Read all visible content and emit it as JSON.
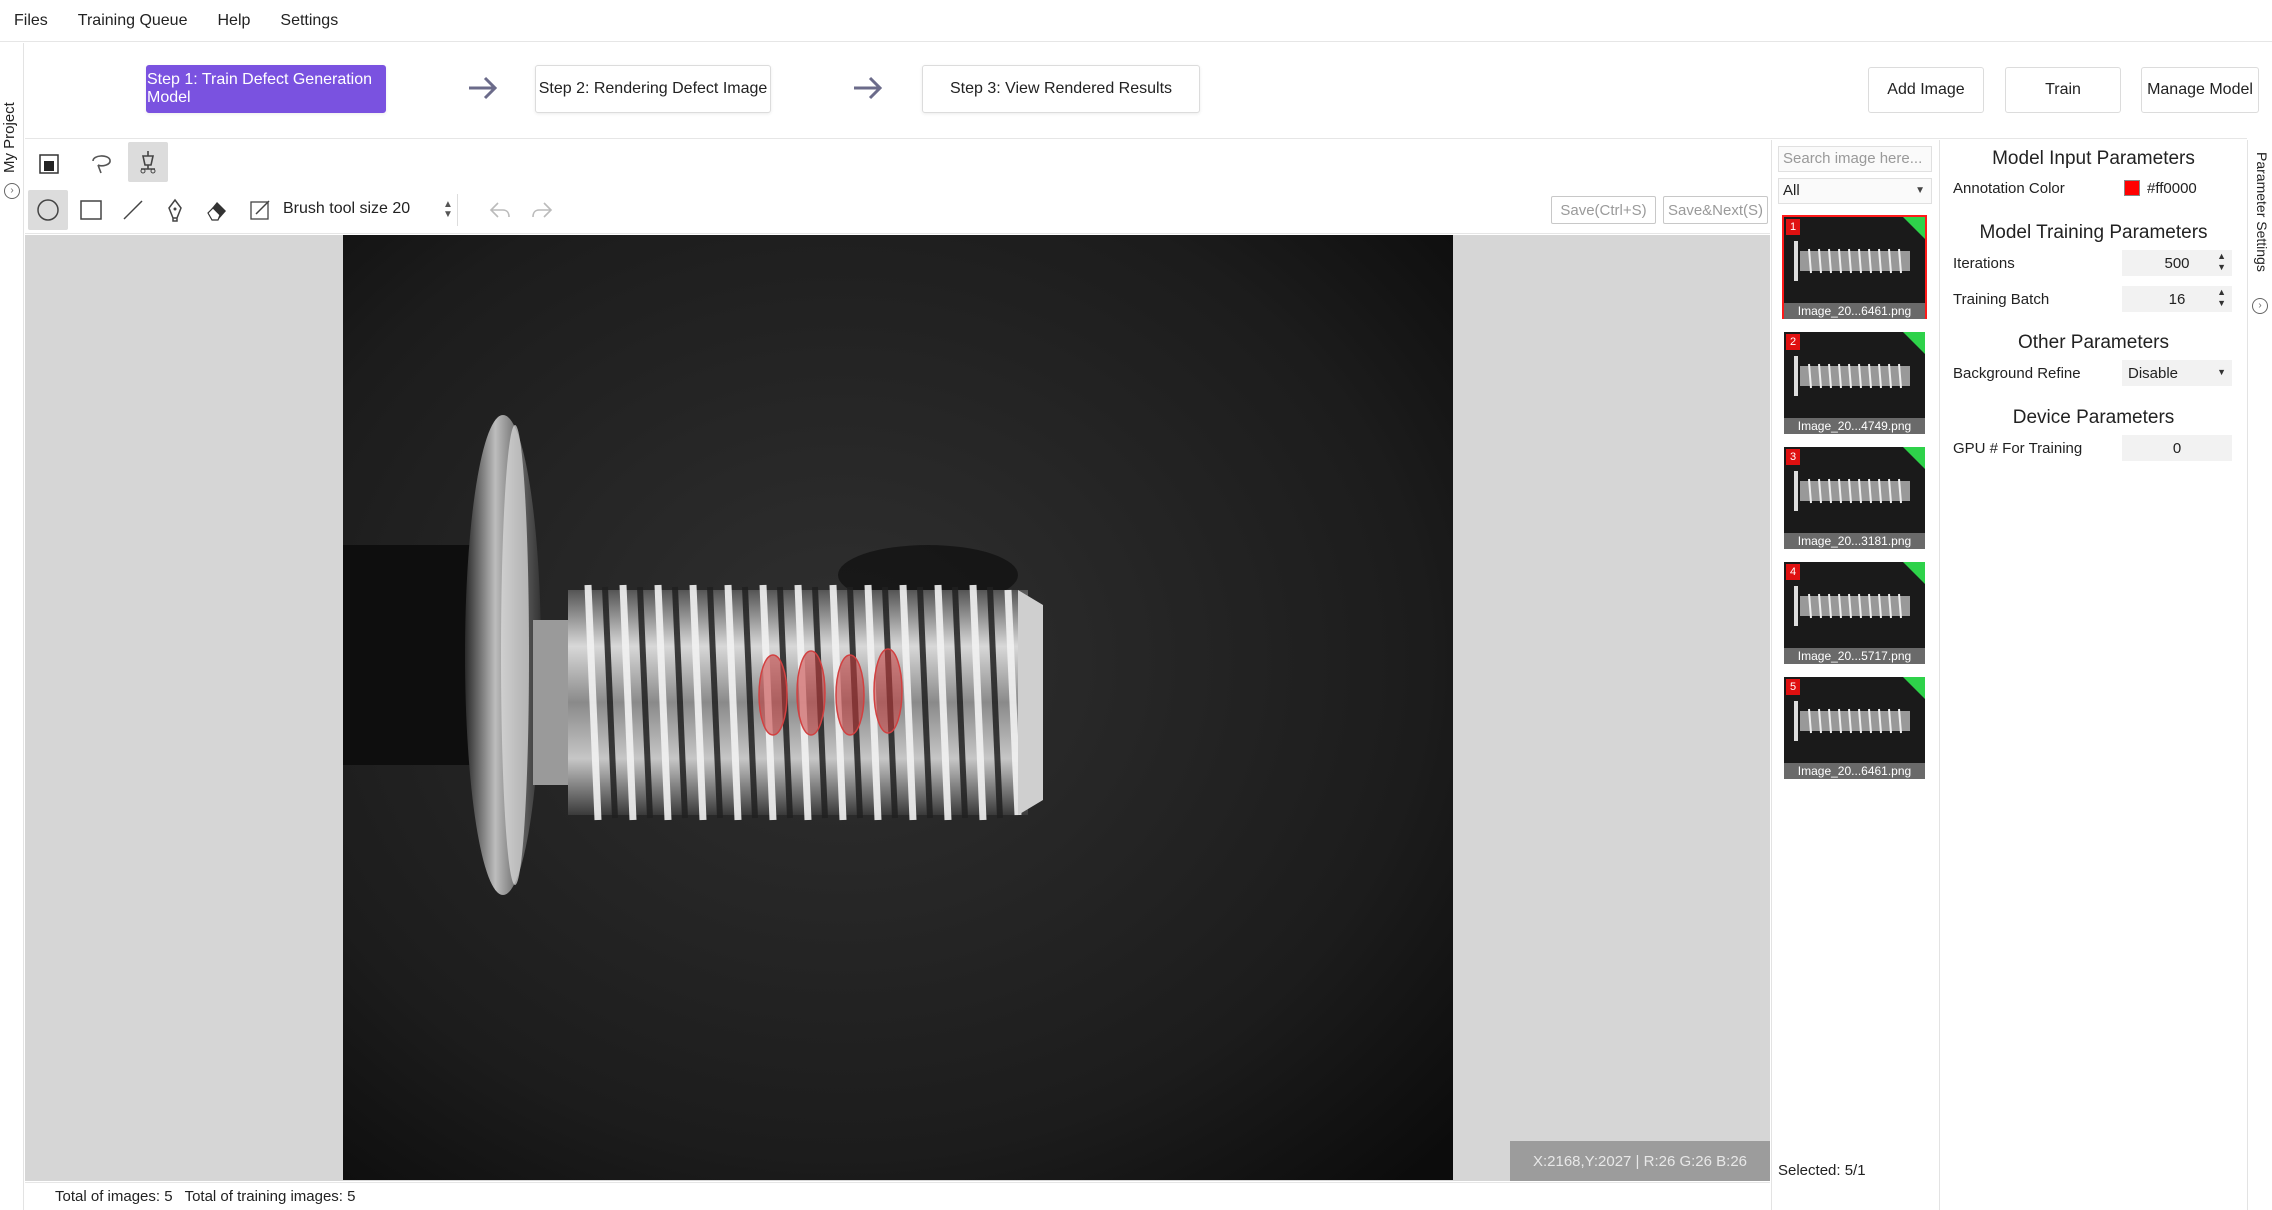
{
  "menu": {
    "files": "Files",
    "training_queue": "Training Queue",
    "help": "Help",
    "settings": "Settings"
  },
  "left_tab": {
    "label": "My Project"
  },
  "steps": {
    "step1": "Step 1: Train Defect Generation Model",
    "step2": "Step 2: Rendering Defect Image",
    "step3": "Step 3: View Rendered Results"
  },
  "header_buttons": {
    "add_image": "Add Image",
    "train": "Train",
    "manage_model": "Manage Model"
  },
  "toolbar": {
    "brush_label": "Brush tool size 20",
    "save": "Save(Ctrl+S)",
    "save_next": "Save&Next(S)",
    "icons": [
      "fill-mask-icon",
      "lasso-icon",
      "pen-tool-icon",
      "circle-icon",
      "rectangle-icon",
      "line-icon",
      "pen-nib-icon",
      "eraser-icon",
      "edit-icon",
      "undo-icon",
      "redo-icon"
    ]
  },
  "canvas": {
    "coord_readout": "X:2168,Y:2027 | R:26 G:26 B:26",
    "annotation_color": "#ff0000"
  },
  "status": {
    "total_images": "Total of images: 5",
    "total_training": "Total of training images: 5"
  },
  "thumbnails": {
    "search_placeholder": "Search image here...",
    "filter_value": "All",
    "selected_count": "Selected: 5/1",
    "items": [
      {
        "num": "1",
        "name": "Image_20...6461.png"
      },
      {
        "num": "2",
        "name": "Image_20...4749.png"
      },
      {
        "num": "3",
        "name": "Image_20...3181.png"
      },
      {
        "num": "4",
        "name": "Image_20...5717.png"
      },
      {
        "num": "5",
        "name": "Image_20...6461.png"
      }
    ]
  },
  "params": {
    "model_input_title": "Model Input Parameters",
    "annotation_color_label": "Annotation Color",
    "annotation_color_value": "#ff0000",
    "model_training_title": "Model Training Parameters",
    "iterations_label": "Iterations",
    "iterations_value": "500",
    "training_batch_label": "Training Batch",
    "training_batch_value": "16",
    "other_title": "Other Parameters",
    "background_refine_label": "Background Refine",
    "background_refine_value": "Disable",
    "device_title": "Device Parameters",
    "gpu_label": "GPU # For Training",
    "gpu_value": "0"
  },
  "right_tab": {
    "label": "Parameter Settings"
  }
}
